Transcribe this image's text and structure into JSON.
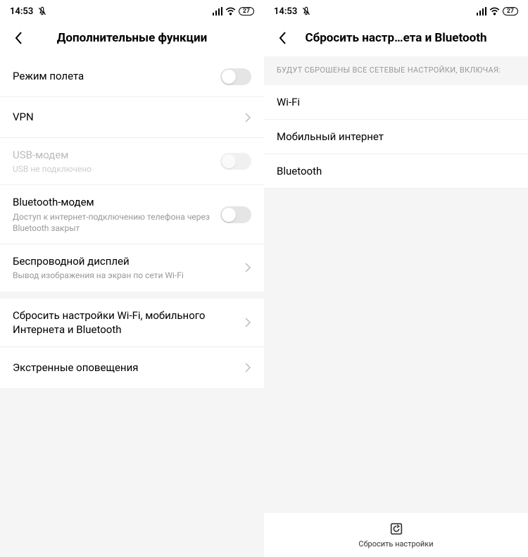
{
  "status": {
    "time": "14:53",
    "battery": "27"
  },
  "left": {
    "title": "Дополнительные функции",
    "rows": {
      "airplane": {
        "title": "Режим полета"
      },
      "vpn": {
        "title": "VPN"
      },
      "usb": {
        "title": "USB-модем",
        "sub": "USB не подключено"
      },
      "bt": {
        "title": "Bluetooth-модем",
        "sub": "Доступ к интернет-подключению телефона через Bluetooth закрыт"
      },
      "cast": {
        "title": "Беспроводной дисплей",
        "sub": "Вывод изображения на экран по сети Wi-Fi"
      },
      "reset": {
        "title": "Сбросить настройки Wi-Fi, мобильного Интернета и Bluetooth"
      },
      "alerts": {
        "title": "Экстренные оповещения"
      }
    }
  },
  "right": {
    "title": "Сбросить настр…ета и Bluetooth",
    "info": "Будут сброшены все сетевые настройки, включая:",
    "items": {
      "wifi": "Wi-Fi",
      "mobile": "Мобильный интернет",
      "bt": "Bluetooth"
    },
    "action": "Сбросить настройки"
  }
}
